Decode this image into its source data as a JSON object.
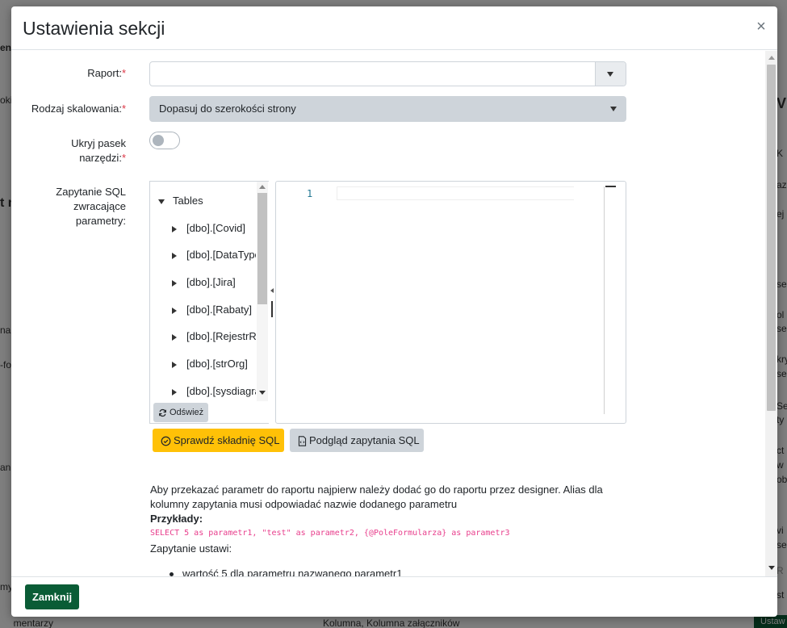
{
  "background": {
    "left_fragments": [
      "ent",
      "oki",
      "t n",
      "na",
      "-fo",
      "ani",
      "my",
      "komentarzy"
    ],
    "right_fragments": [
      "V",
      "K",
      "az",
      "ej",
      "se",
      "ol",
      "se",
      "kry",
      "se",
      "Se",
      "ty",
      "ct",
      "w",
      "ob",
      "vi",
      "se",
      "R",
      "st"
    ],
    "bottom_text": "Kolumna, Kolumna załączników",
    "bottom_right_button": "Ustaw"
  },
  "modal": {
    "title": "Ustawienia sekcji",
    "close_symbol": "×",
    "fields": {
      "raport_label": "Raport:",
      "raport_value": "",
      "rodzaj_label": "Rodzaj skalowania:",
      "rodzaj_value": "Dopasuj do szerokości strony",
      "ukryj_label_1": "Ukryj pasek",
      "ukryj_label_2": "narzędzi:",
      "required_mark": "*",
      "sql_label_1": "Zapytanie SQL",
      "sql_label_2": "zwracające",
      "sql_label_3": "parametry:"
    },
    "tree": {
      "root": "Tables",
      "items": [
        "[dbo].[Covid]",
        "[dbo].[DataTypes]",
        "[dbo].[Jira]",
        "[dbo].[Rabaty]",
        "[dbo].[RejestrRabatow]",
        "[dbo].[strOrg]",
        "[dbo].[sysdiagrams]"
      ],
      "refresh_label": "Odśwież"
    },
    "editor": {
      "line_number": "1",
      "content": ""
    },
    "buttons": {
      "check_syntax": "Sprawdź składnię SQL",
      "preview": "Podgląd zapytania SQL",
      "close": "Zamknij"
    },
    "help": {
      "text": "Aby przekazać parametr do raportu najpierw należy dodać go do raportu przez designer. Alias dla kolumny zapytania musi odpowiadać nazwie dodanego parametru",
      "examples_title": "Przykłady:",
      "code": "SELECT 5 as parametr1, \"test\" as parametr2, {@PoleFormularza} as parametr3",
      "sets_title": "Zapytanie ustawi:",
      "bullet_1": "wartość 5 dla parametru nazwanego parametr1"
    }
  },
  "colors": {
    "required": "#dc3545",
    "warning_button": "#ffc107",
    "close_button": "#0a5c36",
    "code": "#e83e8c"
  }
}
